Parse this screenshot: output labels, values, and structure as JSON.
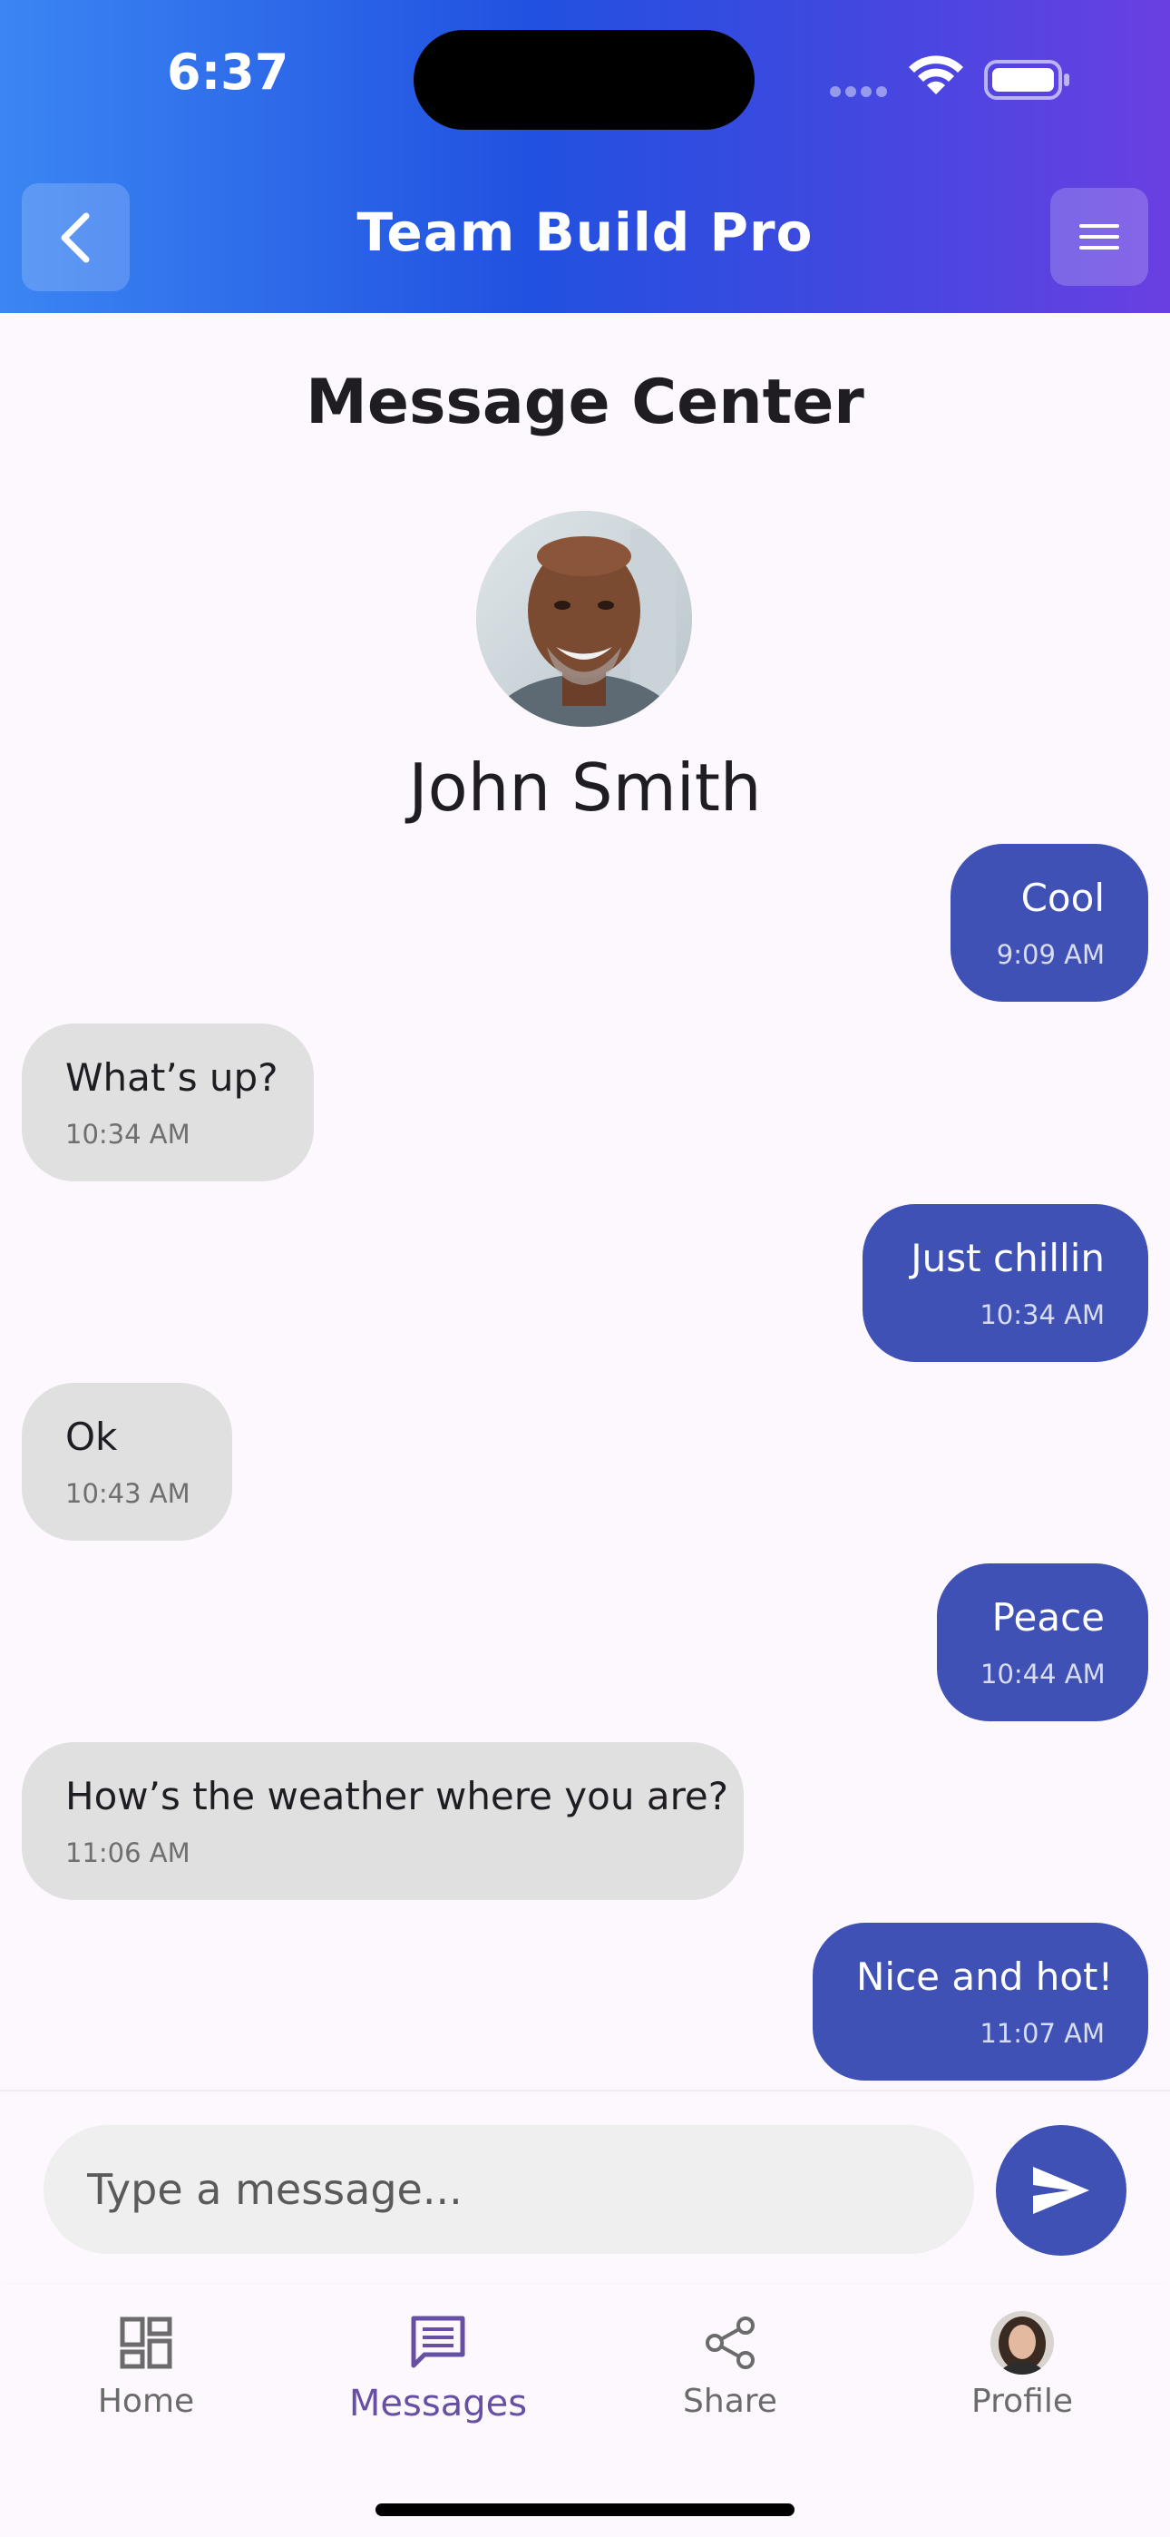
{
  "status_bar": {
    "time": "6:37"
  },
  "app_bar": {
    "title": "Team Build Pro"
  },
  "page": {
    "title": "Message Center"
  },
  "contact": {
    "name": "John Smith"
  },
  "messages": [
    {
      "direction": "sent",
      "text": "Cool",
      "time": "9:09 AM"
    },
    {
      "direction": "received",
      "text": "What’s up?",
      "time": "10:34 AM"
    },
    {
      "direction": "sent",
      "text": "Just chillin",
      "time": "10:34 AM"
    },
    {
      "direction": "received",
      "text": "Ok",
      "time": "10:43 AM"
    },
    {
      "direction": "sent",
      "text": "Peace",
      "time": "10:44 AM"
    },
    {
      "direction": "received",
      "text": "How’s the weather where you are?",
      "time": "11:06 AM"
    },
    {
      "direction": "sent",
      "text": "Nice and hot!",
      "time": "11:07 AM"
    }
  ],
  "composer": {
    "placeholder": "Type a message...",
    "value": ""
  },
  "bottom_nav": {
    "items": [
      {
        "label": "Home",
        "icon": "dashboard-icon"
      },
      {
        "label": "Messages",
        "icon": "message-icon",
        "active": true
      },
      {
        "label": "Share",
        "icon": "share-icon"
      },
      {
        "label": "Profile",
        "icon": "profile-avatar"
      }
    ]
  },
  "colors": {
    "sent_bubble": "#3f51b5",
    "received_bubble": "#e0e0e0",
    "active_nav": "#6750a4",
    "header_gradient_start": "#3b86f3",
    "header_gradient_end": "#6a3fe2"
  }
}
